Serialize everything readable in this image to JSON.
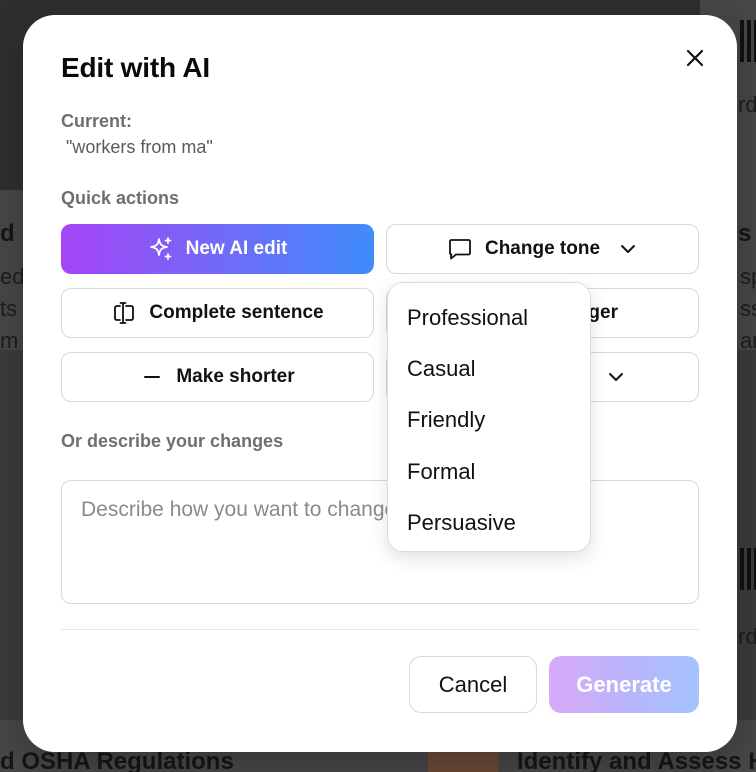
{
  "background": {
    "texts": [
      "d",
      "ede",
      "ts",
      "m",
      "s l",
      "sp",
      "ss",
      "an",
      "rd",
      "rd",
      "d OSHA Regulations",
      "Identify and Assess H"
    ]
  },
  "modal": {
    "title": "Edit with AI",
    "current_label": "Current:",
    "current_value": " \"workers from ma\"",
    "quick_actions_label": "Quick actions",
    "actions": {
      "new_ai_edit": "New AI edit",
      "change_tone": "Change tone",
      "complete_sentence": "Complete sentence",
      "make_longer_partial": "ger",
      "make_shorter": "Make shorter"
    },
    "describe_label": "Or describe your changes",
    "describe_placeholder": "Describe how you want to change this text...",
    "cancel_label": "Cancel",
    "generate_label": "Generate"
  },
  "tone_dropdown": {
    "options": [
      "Professional",
      "Casual",
      "Friendly",
      "Formal",
      "Persuasive"
    ]
  },
  "icons": {
    "close": "close-icon",
    "sparkles": "sparkles-icon",
    "chat": "chat-bubble-icon",
    "chevron": "chevron-down-icon",
    "cursor": "text-cursor-icon",
    "minus": "minus-icon"
  },
  "colors": {
    "primary_gradient_start": "#a545f6",
    "primary_gradient_end": "#3f8cfb",
    "generate_disabled_start": "#d7aaf9",
    "generate_disabled_end": "#a3c3fd"
  }
}
